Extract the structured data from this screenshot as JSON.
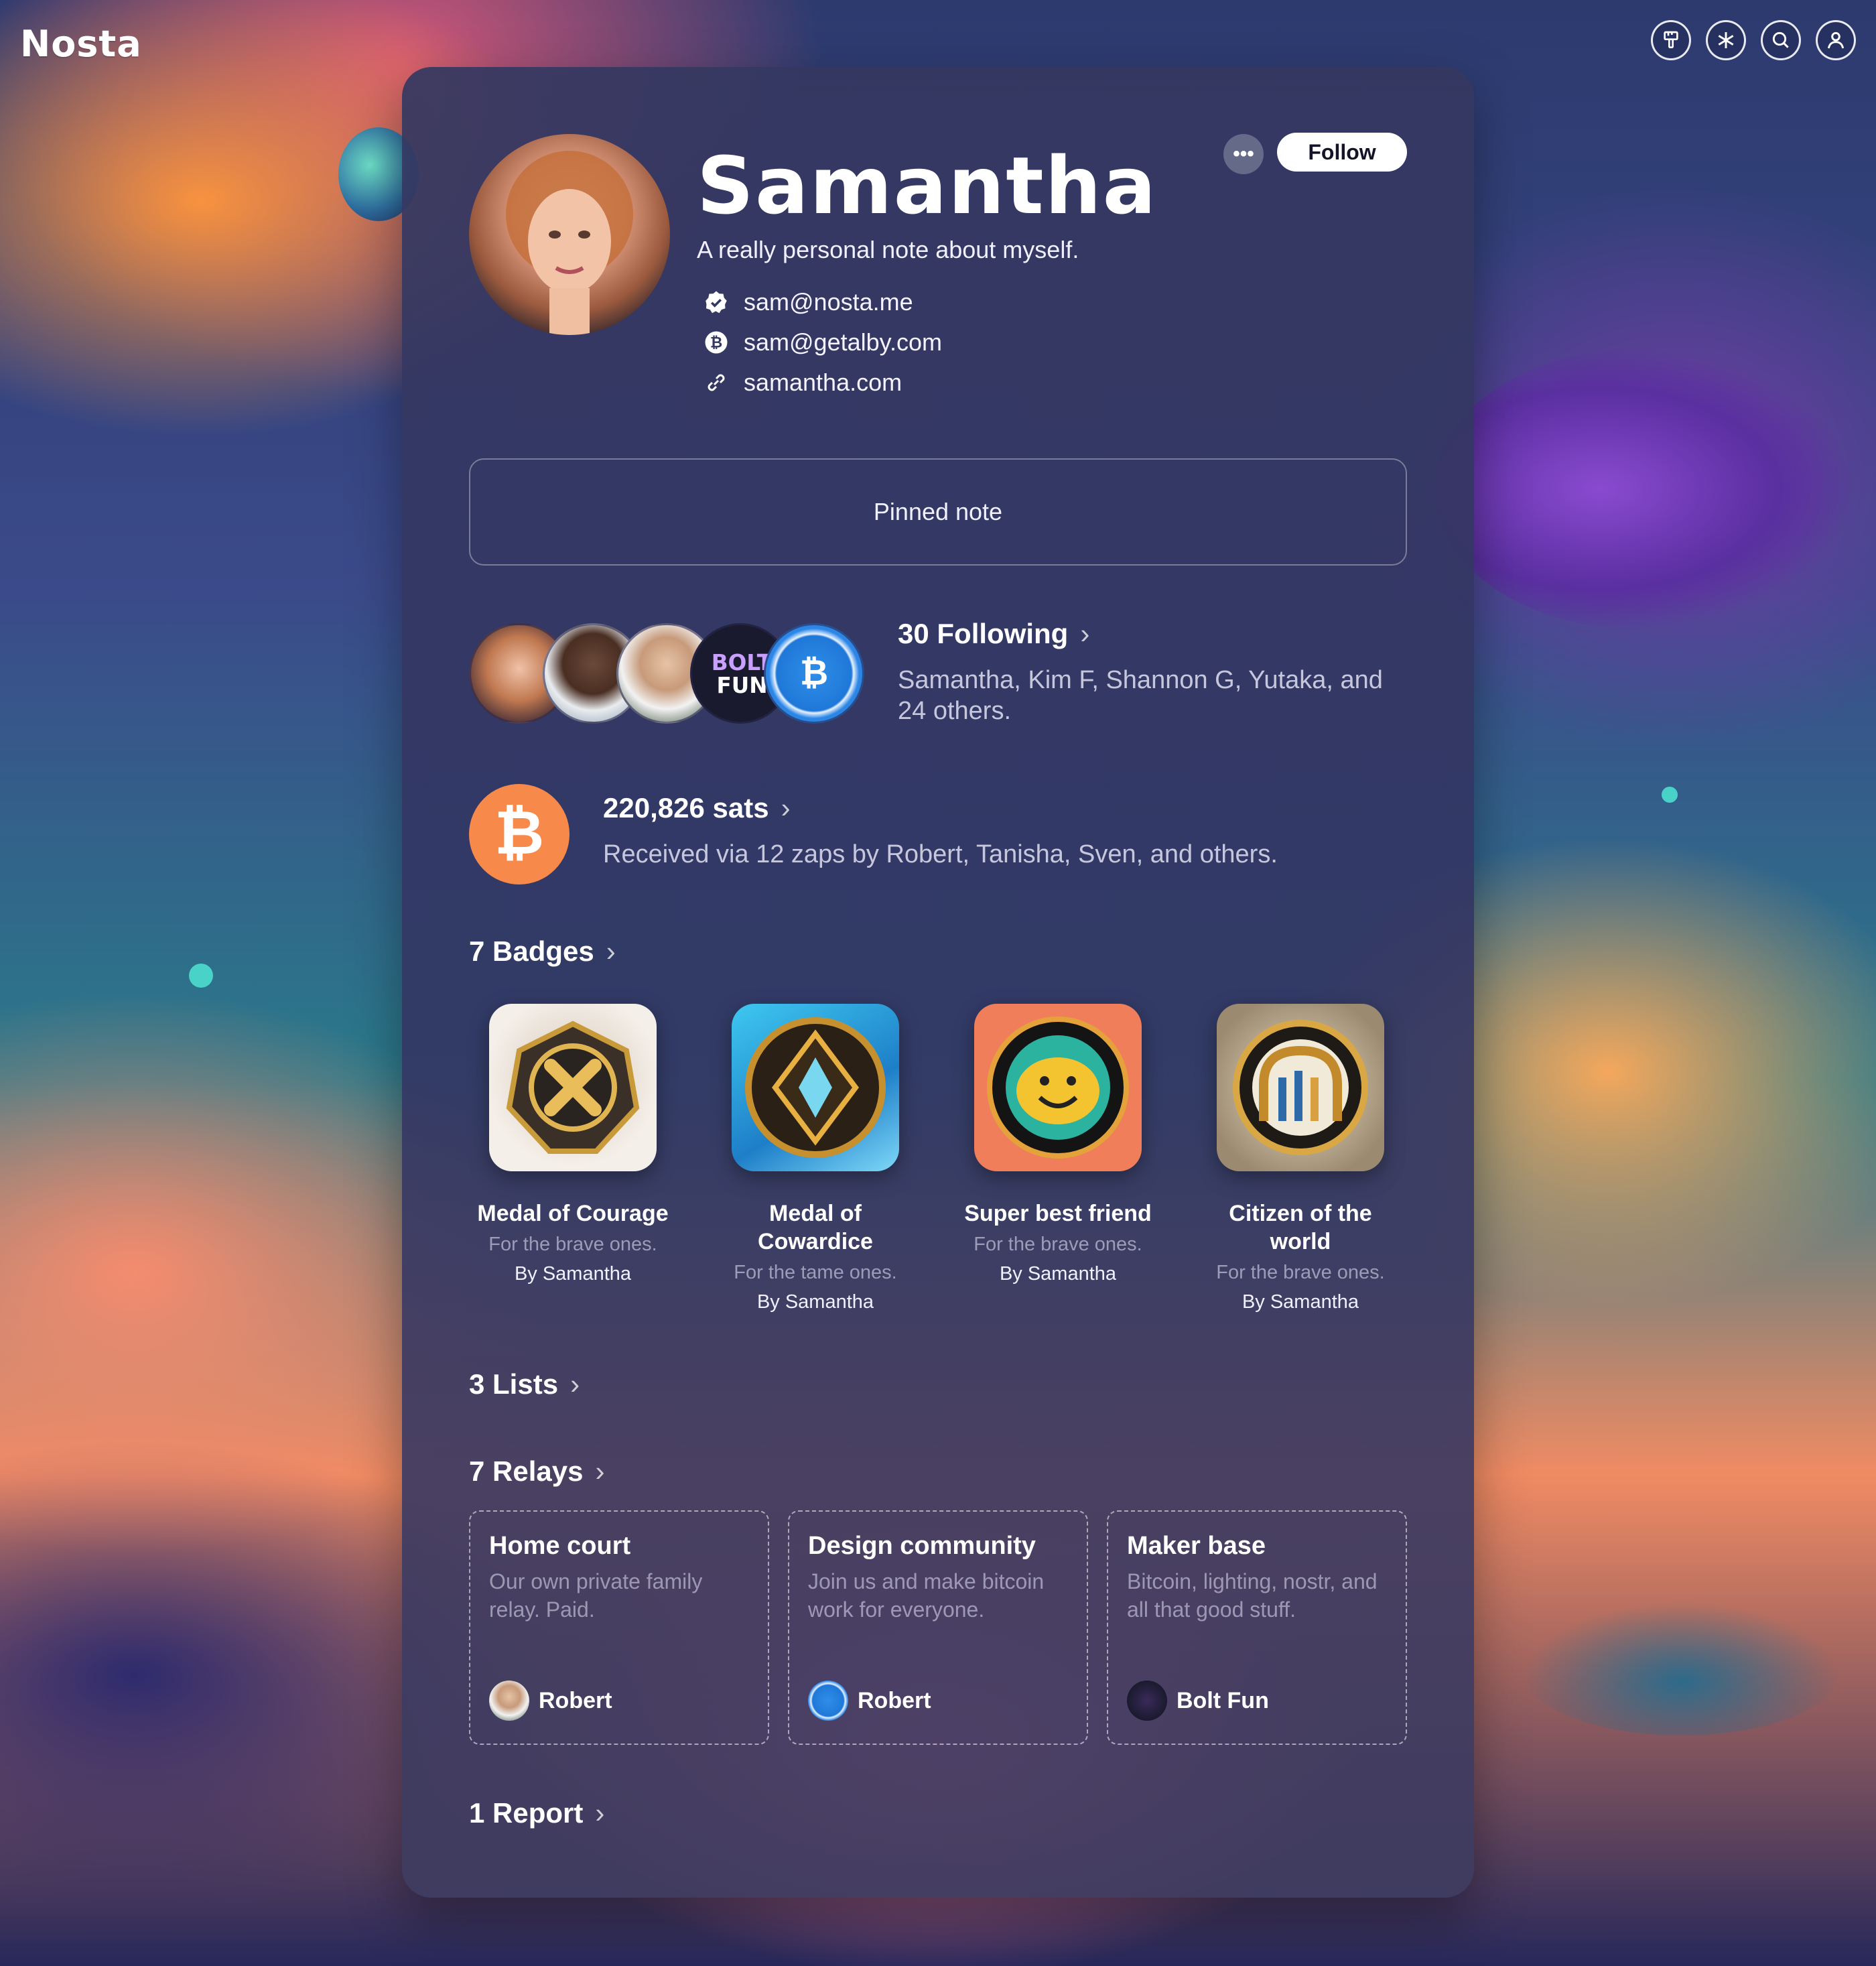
{
  "app": {
    "logo": "Nosta"
  },
  "topbar": {
    "icons": [
      "paintbrush-icon",
      "sparkle-icon",
      "search-icon",
      "user-icon"
    ]
  },
  "profile": {
    "name": "Samantha",
    "bio": "A really personal note about myself.",
    "nip05": "sam@nosta.me",
    "lightning": "sam@getalby.com",
    "website": "samantha.com",
    "more_label": "•••",
    "follow_label": "Follow"
  },
  "pinned": {
    "label": "Pinned note"
  },
  "following": {
    "title": "30 Following",
    "summary": "Samantha, Kim F, Shannon G, Yutaka, and 24 others."
  },
  "zaps": {
    "title": "220,826 sats",
    "summary": "Received via 12 zaps by Robert, Tanisha, Sven, and others."
  },
  "badges": {
    "title": "7 Badges",
    "items": [
      {
        "title": "Medal of Courage",
        "desc": "For the brave ones.",
        "by": "By Samantha"
      },
      {
        "title": "Medal of Cowardice",
        "desc": "For the tame ones.",
        "by": "By Samantha"
      },
      {
        "title": "Super best friend",
        "desc": "For the brave ones.",
        "by": "By Samantha"
      },
      {
        "title": "Citizen of the world",
        "desc": "For the brave ones.",
        "by": "By Samantha"
      }
    ]
  },
  "lists": {
    "title": "3 Lists"
  },
  "relays": {
    "title": "7 Relays",
    "items": [
      {
        "title": "Home court",
        "desc": "Our own private family relay. Paid.",
        "owner": "Robert"
      },
      {
        "title": "Design community",
        "desc": "Join us and make bitcoin work for everyone.",
        "owner": "Robert"
      },
      {
        "title": "Maker base",
        "desc": "Bitcoin, lighting, nostr, and all that good stuff.",
        "owner": "Bolt Fun"
      }
    ]
  },
  "reports": {
    "title": "1 Report"
  },
  "colors": {
    "accent_orange": "#f7894a",
    "card_bg": "#343860"
  }
}
